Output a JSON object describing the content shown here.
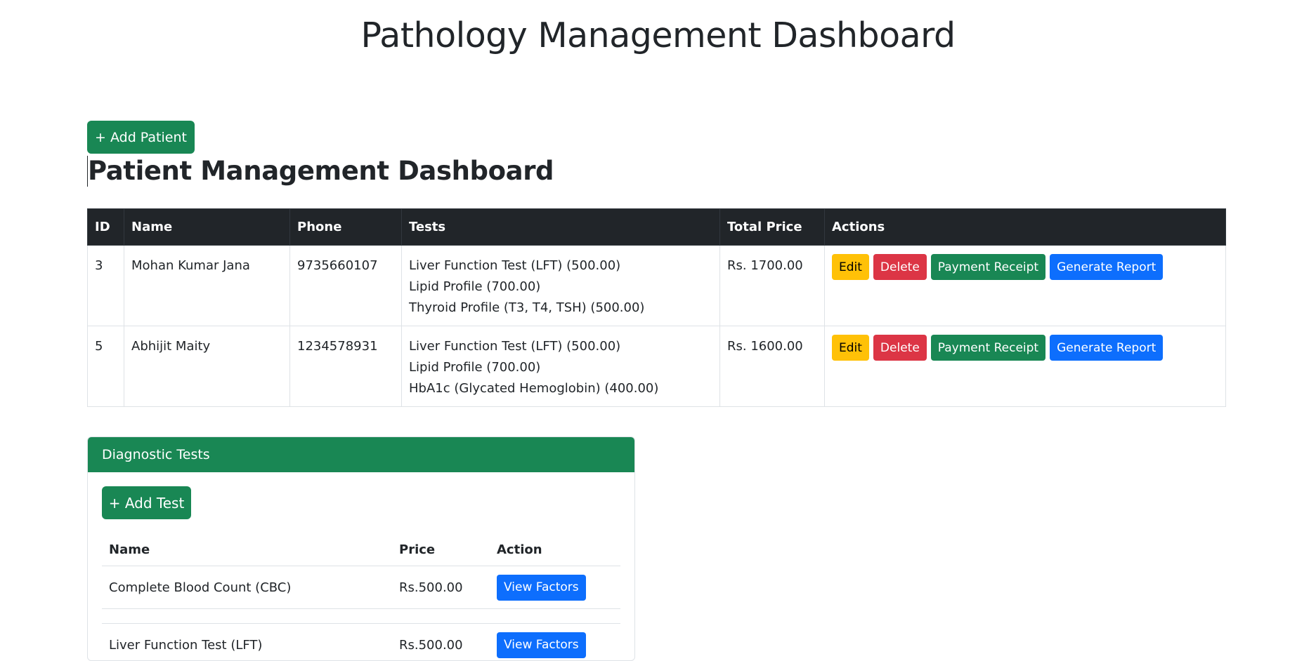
{
  "page": {
    "title": "Pathology Management Dashboard"
  },
  "patients": {
    "add_button": "+ Add Patient",
    "title": "Patient Management Dashboard",
    "columns": [
      "ID",
      "Name",
      "Phone",
      "Tests",
      "Total Price",
      "Actions"
    ],
    "rows": [
      {
        "id": "3",
        "name": "Mohan Kumar Jana",
        "phone": "9735660107",
        "tests": [
          "Liver Function Test (LFT) (500.00)",
          "Lipid Profile (700.00)",
          "Thyroid Profile (T3, T4, TSH) (500.00)"
        ],
        "total": "Rs. 1700.00"
      },
      {
        "id": "5",
        "name": "Abhijit Maity",
        "phone": "1234578931",
        "tests": [
          "Liver Function Test (LFT) (500.00)",
          "Lipid Profile (700.00)",
          "HbA1c (Glycated Hemoglobin) (400.00)"
        ],
        "total": "Rs. 1600.00"
      }
    ],
    "actions": {
      "edit": "Edit",
      "delete": "Delete",
      "receipt": "Payment Receipt",
      "report": "Generate Report"
    }
  },
  "tests_card": {
    "header": "Diagnostic Tests",
    "add_button": "+ Add Test",
    "columns": [
      "Name",
      "Price",
      "Action"
    ],
    "rows": [
      {
        "name": "Complete Blood Count (CBC)",
        "price": "Rs.500.00"
      },
      {
        "name": "Liver Function Test (LFT)",
        "price": "Rs.500.00"
      }
    ],
    "view_label": "View Factors"
  },
  "colors": {
    "success": "#198754",
    "danger": "#dc3545",
    "warning": "#ffc107",
    "primary": "#0d6efd",
    "dark": "#212529"
  }
}
